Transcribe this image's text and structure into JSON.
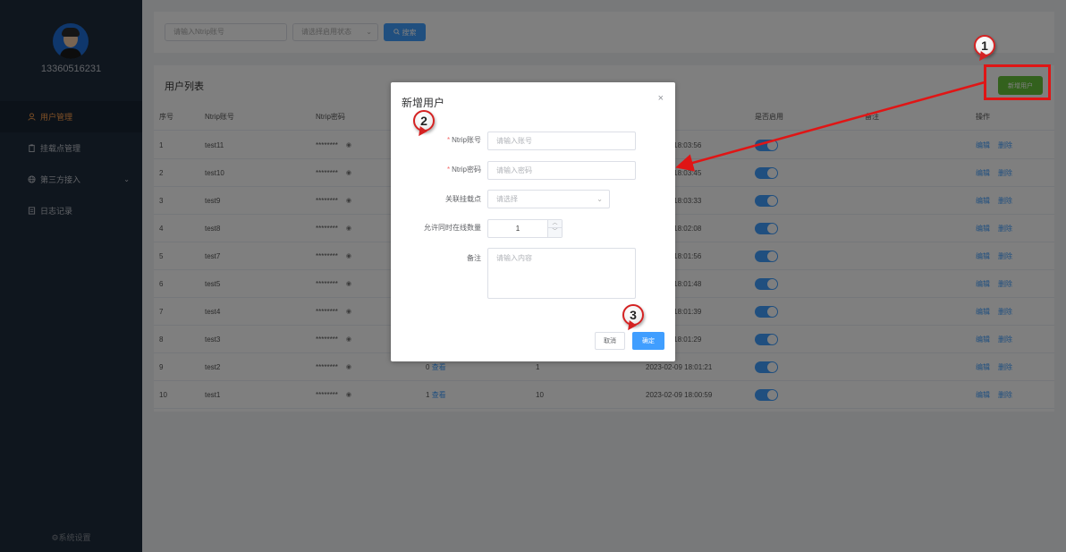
{
  "sidebar": {
    "username": "13360516231",
    "menu": [
      {
        "label": "用户管理",
        "icon": "user-icon",
        "active": true
      },
      {
        "label": "挂载点管理",
        "icon": "clipboard-icon"
      },
      {
        "label": "第三方接入",
        "icon": "globe-icon",
        "has_submenu": true
      },
      {
        "label": "日志记录",
        "icon": "document-icon"
      }
    ],
    "settings_label": "⚙系统设置"
  },
  "search": {
    "account_placeholder": "请输入Ntrip账号",
    "status_placeholder": "请选择启用状态",
    "search_label": "搜索"
  },
  "panel": {
    "title": "用户列表",
    "add_button": "新增用户"
  },
  "table": {
    "headers": {
      "index": "序号",
      "account": "Ntrip账号",
      "password": "Ntrip密码",
      "enabled": "是否启用",
      "remark": "备注",
      "actions": "操作"
    },
    "password_mask": "********",
    "view_label": "查看",
    "edit_label": "编辑",
    "delete_label": "删除",
    "rows": [
      {
        "index": "1",
        "account": "test11",
        "time": "09 18:03:56",
        "enabled": true
      },
      {
        "index": "2",
        "account": "test10",
        "time": "09 18:03:45",
        "enabled": true
      },
      {
        "index": "3",
        "account": "test9",
        "time": "09 18:03:33",
        "enabled": true
      },
      {
        "index": "4",
        "account": "test8",
        "time": "09 18:02:08",
        "enabled": true
      },
      {
        "index": "5",
        "account": "test7",
        "time": "09 18:01:56",
        "enabled": true
      },
      {
        "index": "6",
        "account": "test5",
        "time": "09 18:01:48",
        "enabled": true
      },
      {
        "index": "7",
        "account": "test4",
        "time": "09 18:01:39",
        "enabled": true
      },
      {
        "index": "8",
        "account": "test3",
        "time": "09 18:01:29",
        "enabled": true
      },
      {
        "index": "9",
        "account": "test2",
        "mounts": "0",
        "online": "1",
        "time": "2023-02-09 18:01:21",
        "enabled": true
      },
      {
        "index": "10",
        "account": "test1",
        "mounts": "1",
        "online": "10",
        "time": "2023-02-09 18:00:59",
        "enabled": true
      }
    ]
  },
  "dialog": {
    "title": "新增用户",
    "close": "×",
    "fields": {
      "account_label": "Ntrip账号",
      "account_placeholder": "请输入账号",
      "password_label": "Ntrip密码",
      "password_placeholder": "请输入密码",
      "mount_label": "关联挂载点",
      "mount_placeholder": "请选择",
      "online_label": "允许同时在线数量",
      "online_value": "1",
      "remark_label": "备注",
      "remark_placeholder": "请输入内容"
    },
    "cancel_label": "取消",
    "confirm_label": "确定"
  },
  "annotations": {
    "step1": "1",
    "step2": "2",
    "step3": "3",
    "color": "#e01515"
  }
}
